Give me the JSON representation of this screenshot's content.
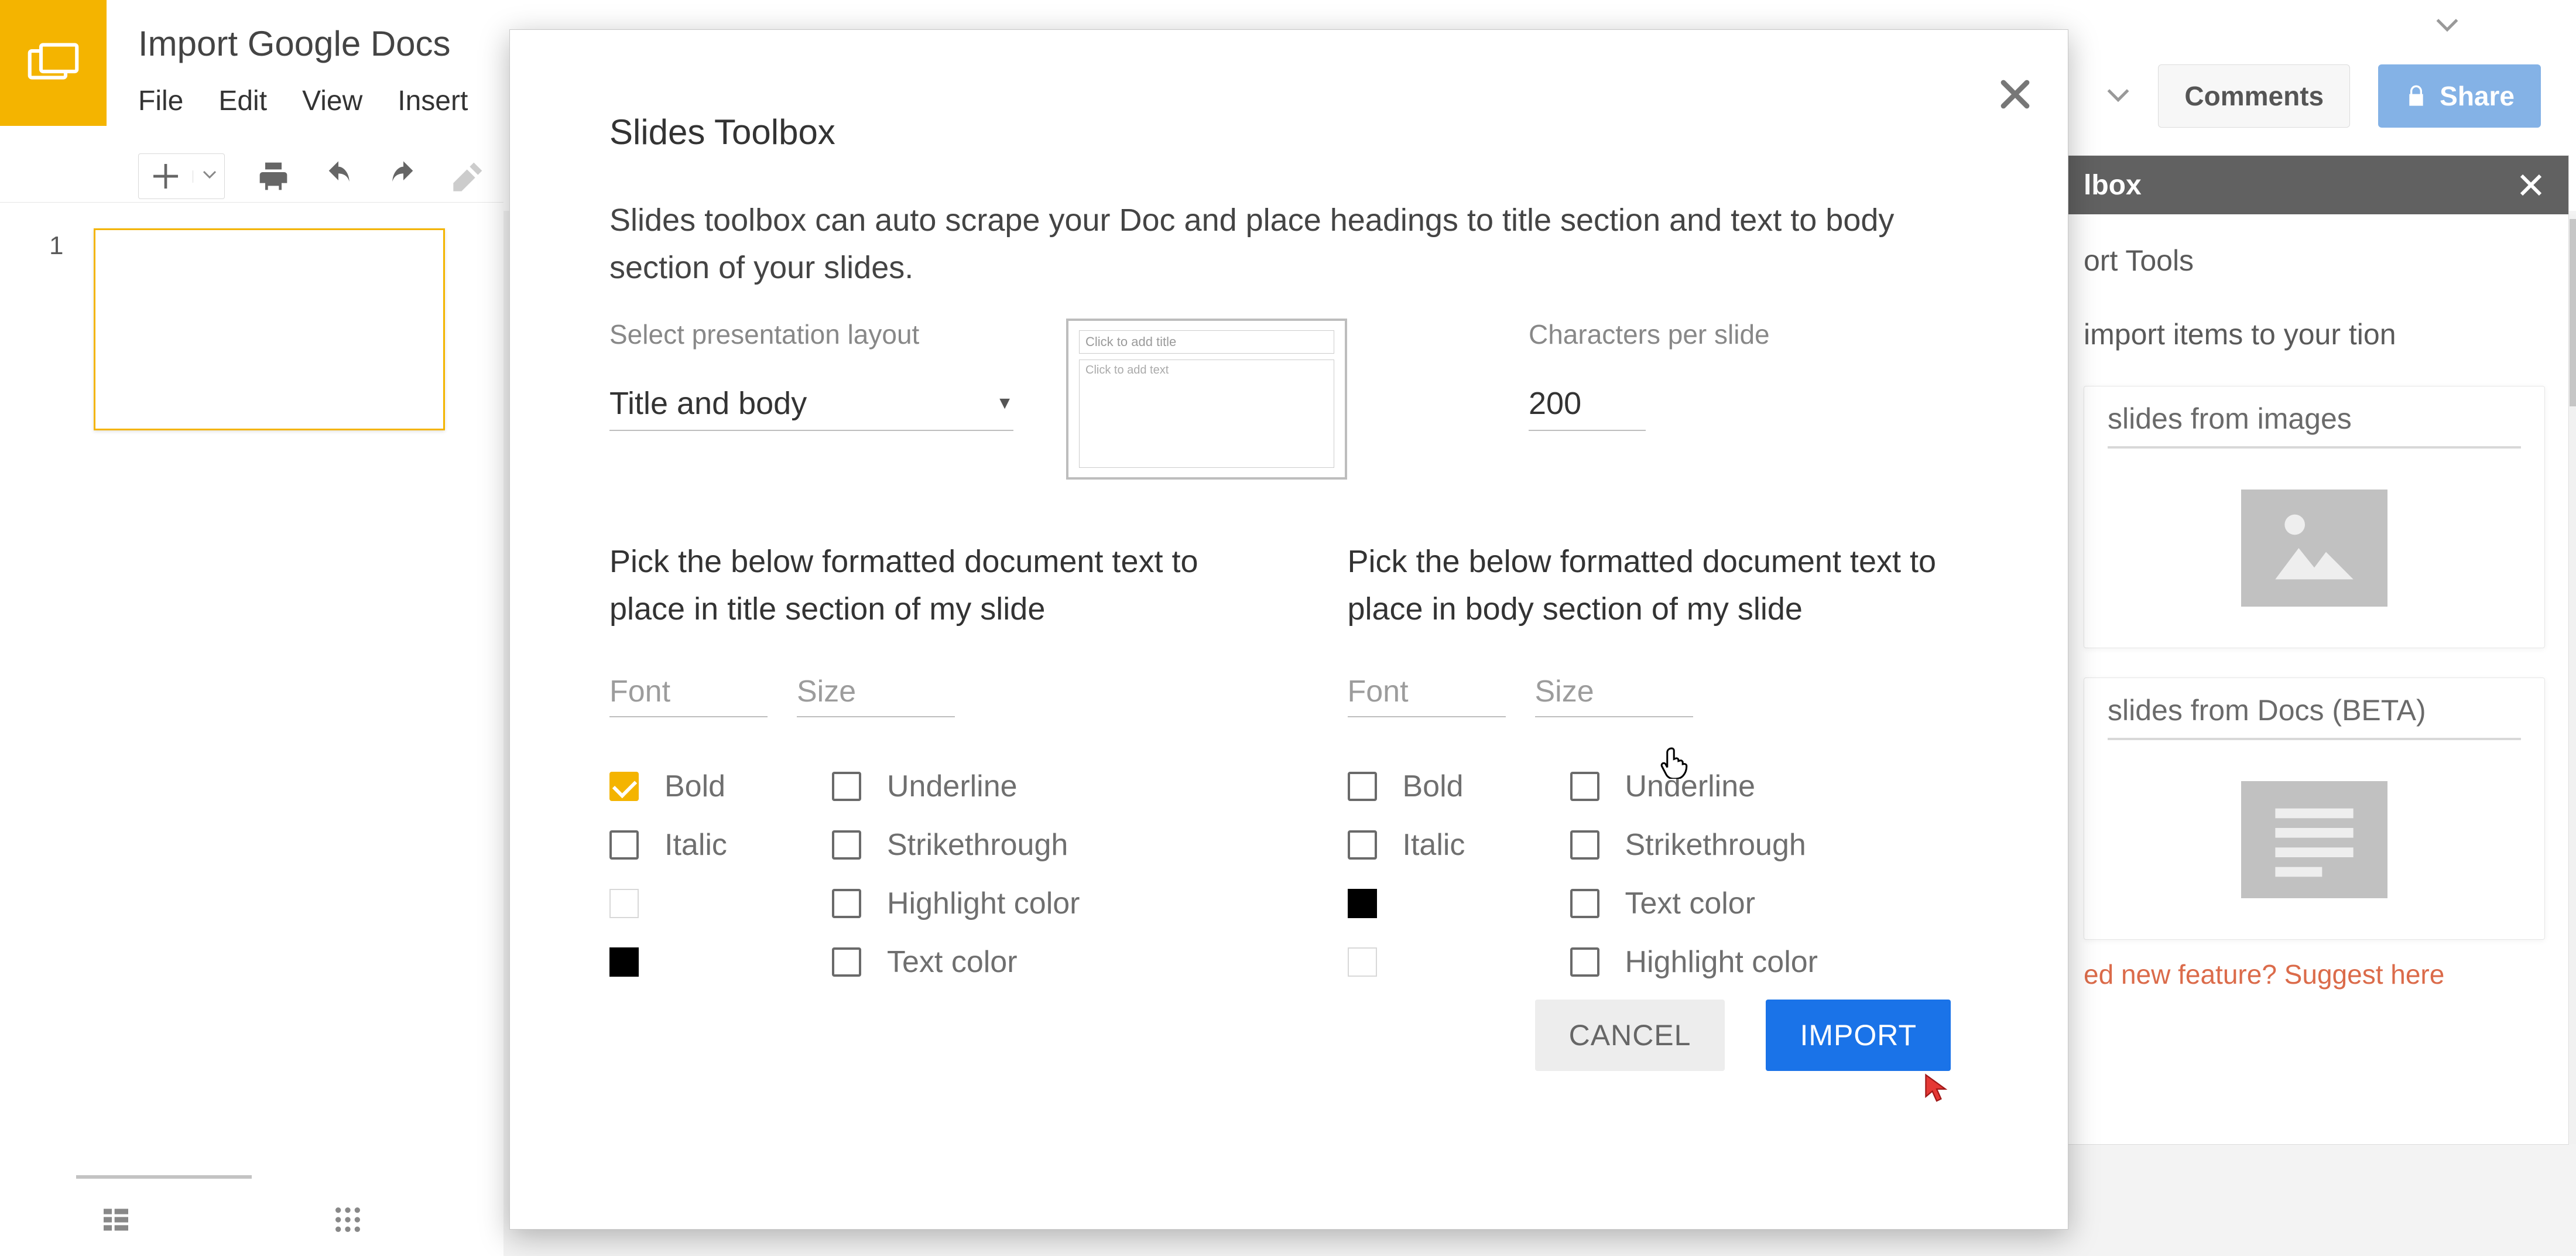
{
  "app": {
    "document_title": "Import Google Docs",
    "menus": [
      "File",
      "Edit",
      "View",
      "Insert"
    ],
    "header_buttons": {
      "comments": "Comments",
      "share": "Share"
    },
    "slide_number": "1"
  },
  "side_panel": {
    "title_visible": "lbox",
    "section_label_visible": "ort Tools",
    "intro_visible": "import items to your tion",
    "card1_title_visible": "slides from images",
    "card2_title_visible": "slides from Docs (BETA)",
    "suggest_visible": "ed new feature? Suggest here"
  },
  "dialog": {
    "title": "Slides Toolbox",
    "description": "Slides toolbox can auto scrape your Doc and place headings to title section and text to body section of your slides.",
    "layout_label": "Select presentation layout",
    "layout_value": "Title and body",
    "layout_thumb_title": "Click to add title",
    "layout_thumb_body": "Click to add text",
    "cps_label": "Characters per slide",
    "cps_value": "200",
    "title_section_heading": "Pick the below formatted document text to place in title section of my slide",
    "body_section_heading": "Pick the below formatted document text to place in body section of my slide",
    "font_label": "Font",
    "size_label": "Size",
    "checkbox_labels": {
      "bold": "Bold",
      "italic": "Italic",
      "underline": "Underline",
      "strikethrough": "Strikethrough",
      "highlight": "Highlight color",
      "textcolor": "Text color"
    },
    "buttons": {
      "cancel": "CANCEL",
      "import": "IMPORT"
    },
    "title_section_state": {
      "bold": true,
      "italic": false,
      "underline": false,
      "strikethrough": false,
      "highlight": false,
      "textcolor": false,
      "swatch1": "#ffffff",
      "swatch2": "#000000"
    },
    "body_section_state": {
      "bold": false,
      "italic": false,
      "underline": false,
      "strikethrough": false,
      "textcolor": false,
      "highlight": false,
      "swatch1": "#000000",
      "swatch2": "#ffffff"
    }
  }
}
